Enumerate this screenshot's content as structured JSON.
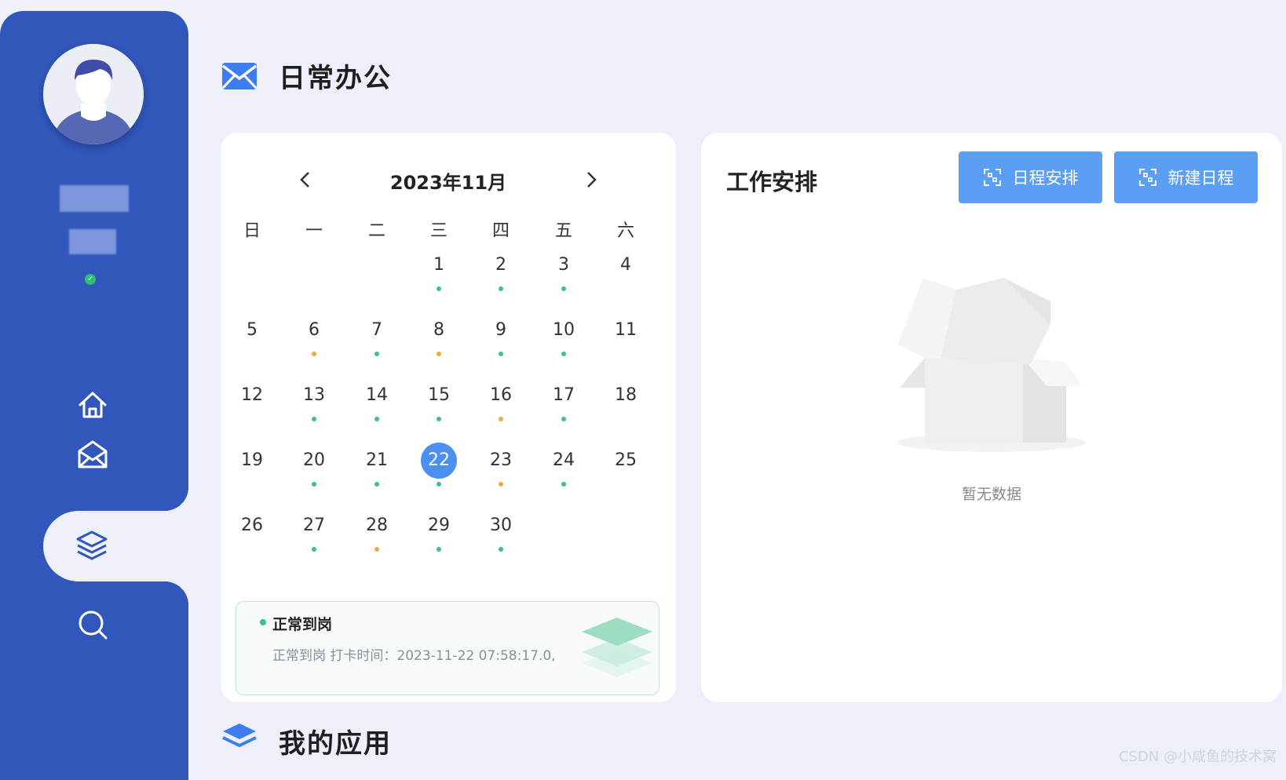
{
  "sidebar": {
    "nav": [
      {
        "name": "home",
        "icon": "home-icon"
      },
      {
        "name": "mail",
        "icon": "mail-icon"
      },
      {
        "name": "layers",
        "icon": "layers-icon",
        "active": true
      },
      {
        "name": "search",
        "icon": "search-icon"
      }
    ],
    "status_icon": "check-icon"
  },
  "section_daily": {
    "title": "日常办公",
    "icon": "mail-icon"
  },
  "section_apps": {
    "title": "我的应用",
    "icon": "layers-icon"
  },
  "calendar": {
    "title": "2023年11月",
    "weekdays": [
      "日",
      "一",
      "二",
      "三",
      "四",
      "五",
      "六"
    ],
    "days": [
      {
        "day": "1",
        "status": "green"
      },
      {
        "day": "2",
        "status": "green"
      },
      {
        "day": "3",
        "status": "green"
      },
      {
        "day": "4",
        "status": ""
      },
      {
        "day": "5",
        "status": ""
      },
      {
        "day": "6",
        "status": "orange"
      },
      {
        "day": "7",
        "status": "green"
      },
      {
        "day": "8",
        "status": "orange"
      },
      {
        "day": "9",
        "status": "green"
      },
      {
        "day": "10",
        "status": "green"
      },
      {
        "day": "11",
        "status": ""
      },
      {
        "day": "12",
        "status": ""
      },
      {
        "day": "13",
        "status": "green"
      },
      {
        "day": "14",
        "status": "green"
      },
      {
        "day": "15",
        "status": "green"
      },
      {
        "day": "16",
        "status": "orange"
      },
      {
        "day": "17",
        "status": "green"
      },
      {
        "day": "18",
        "status": ""
      },
      {
        "day": "19",
        "status": ""
      },
      {
        "day": "20",
        "status": "green"
      },
      {
        "day": "21",
        "status": "green"
      },
      {
        "day": "22",
        "status": "green",
        "today": true
      },
      {
        "day": "23",
        "status": "orange"
      },
      {
        "day": "24",
        "status": "green"
      },
      {
        "day": "25",
        "status": ""
      },
      {
        "day": "26",
        "status": ""
      },
      {
        "day": "27",
        "status": "green"
      },
      {
        "day": "28",
        "status": "orange"
      },
      {
        "day": "29",
        "status": "green"
      },
      {
        "day": "30",
        "status": "green"
      }
    ],
    "colors": {
      "green": "#3cc08d",
      "orange": "#f0a93a",
      "today": "#4b8ff0"
    }
  },
  "attendance": {
    "title": "正常到岗",
    "desc": "正常到岗 打卡时间：2023-11-22 07:58:17.0,"
  },
  "work": {
    "title": "工作安排",
    "btn_schedule": "日程安排",
    "btn_new": "新建日程",
    "empty_text": "暂无数据"
  },
  "watermark": "CSDN @小咸鱼的技术窝",
  "colors": {
    "sidebar": "#3157bd",
    "accent": "#5b9ff5",
    "background": "#eef1fa"
  }
}
